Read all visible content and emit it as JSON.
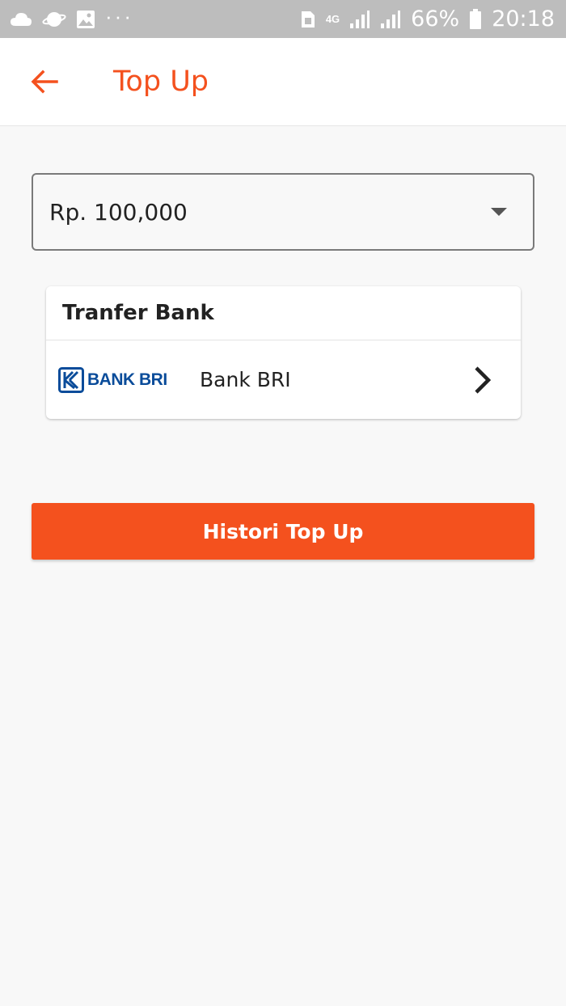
{
  "status_bar": {
    "network_type": "4G",
    "battery": "66%",
    "time": "20:18",
    "icons": [
      "cloud-icon",
      "planet-icon",
      "image-icon",
      "more-icon",
      "sim-icon",
      "signal-icon",
      "signal-icon",
      "battery-icon"
    ]
  },
  "app_bar": {
    "title": "Top Up",
    "back_icon": "arrow-left-icon"
  },
  "amount": {
    "selected": "Rp. 100,000"
  },
  "bank_section": {
    "title": "Tranfer Bank",
    "items": [
      {
        "logo_text": "BANK BRI",
        "name": "Bank BRI"
      }
    ]
  },
  "history_button": {
    "label": "Histori Top Up"
  },
  "colors": {
    "accent": "#f4511e",
    "status_bar": "#bdbdbd",
    "background": "#f8f8f8",
    "bri_blue": "#0a4c9a"
  }
}
